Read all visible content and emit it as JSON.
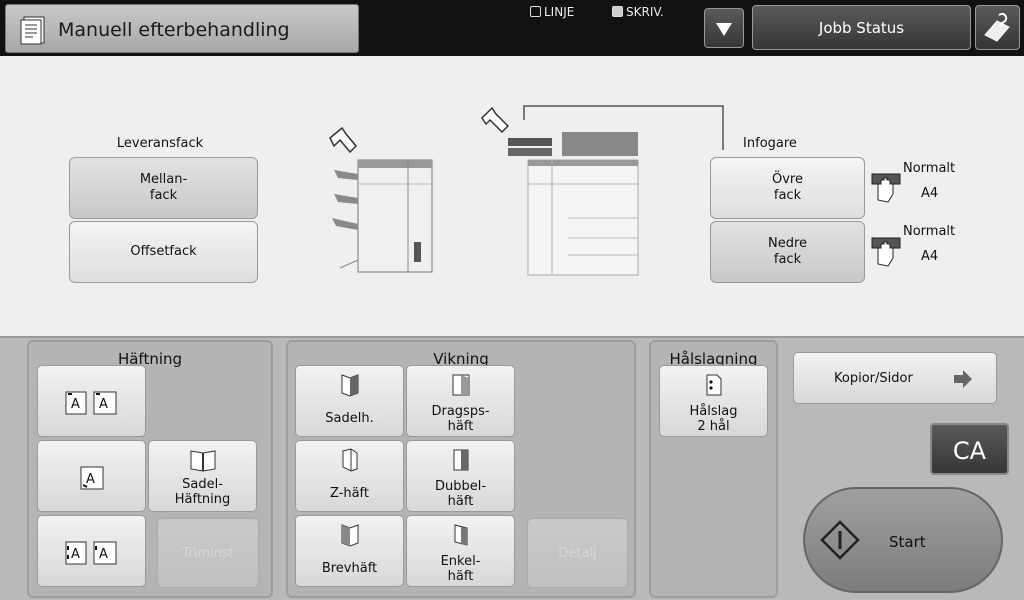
{
  "header": {
    "mode_title": "Manuell efterbehandling",
    "checkbox_line": "LINJE",
    "checkbox_print": "SKRIV.",
    "job_status": "Jobb Status"
  },
  "output_tray": {
    "label": "Leveransfack",
    "middle_line1": "Mellan-",
    "middle_line2": "fack",
    "offset": "Offsetfack"
  },
  "inserter": {
    "label": "Infogare",
    "upper_line1": "Övre",
    "upper_line2": "fack",
    "upper_type": "Normalt",
    "upper_size": "A4",
    "lower_line1": "Nedre",
    "lower_line2": "fack",
    "lower_type": "Normalt",
    "lower_size": "A4"
  },
  "stapling": {
    "title": "Häftning",
    "saddle_line1": "Sadel-",
    "saddle_line2": "Häftning",
    "trim": "Triminst"
  },
  "folding": {
    "title": "Vikning",
    "saddle": "Sadelh.",
    "gatefold_line1": "Dragsps-",
    "gatefold_line2": "häft",
    "zfold": "Z-häft",
    "double_line1": "Dubbel-",
    "double_line2": "häft",
    "letter": "Brevhäft",
    "single_line1": "Enkel-",
    "single_line2": "häft",
    "detail": "Detalj"
  },
  "punch": {
    "title": "Hålslagning",
    "btn_line1": "Hålslag",
    "btn_line2": "2 hål"
  },
  "right": {
    "copies_pages": "Kopior/Sidor",
    "ca": "CA",
    "start": "Start"
  }
}
